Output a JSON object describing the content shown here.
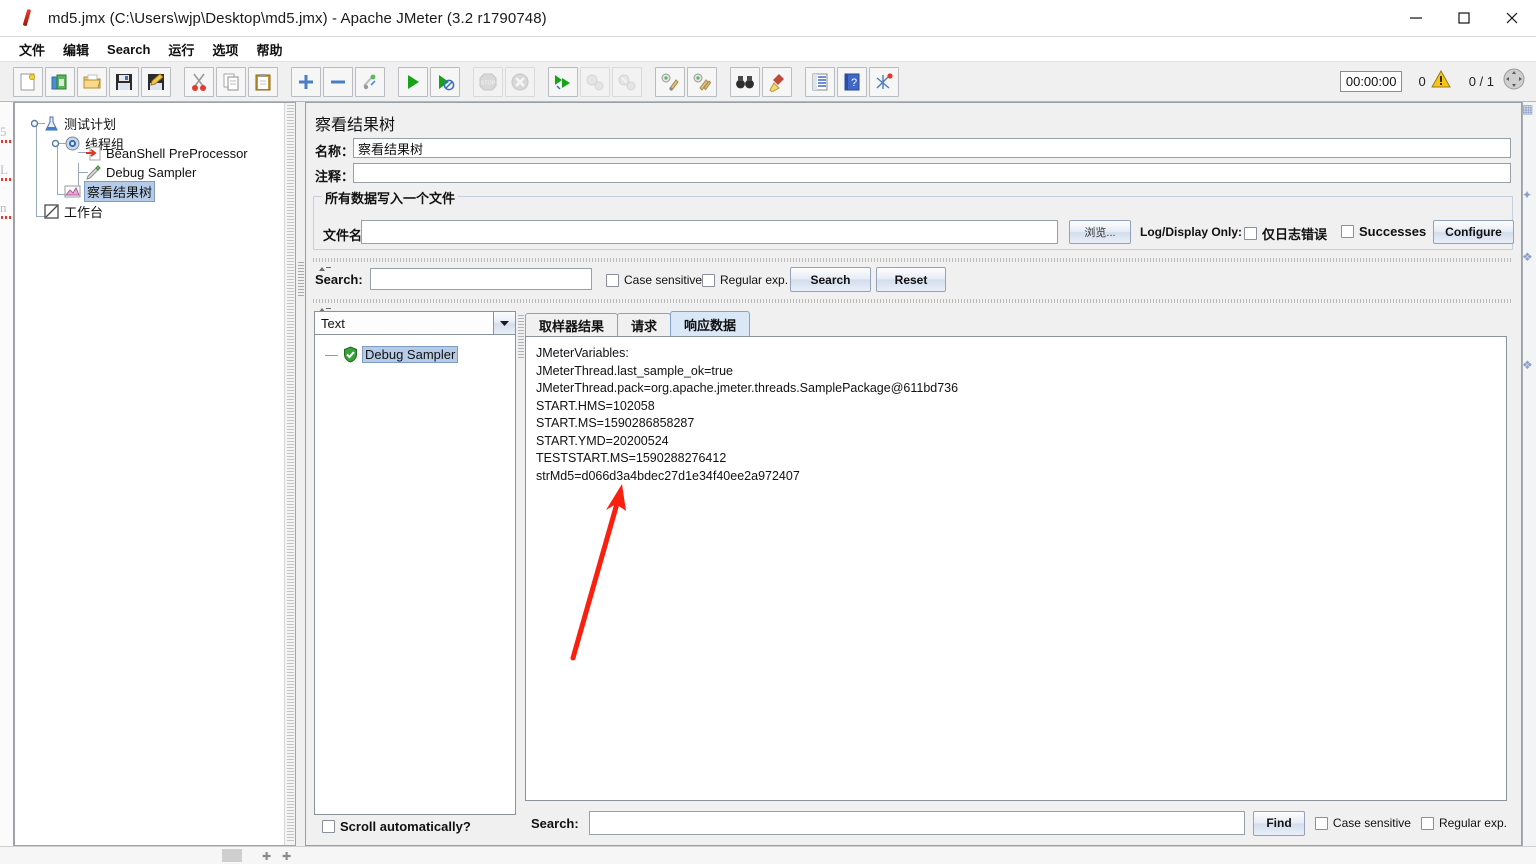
{
  "window": {
    "title": "md5.jmx (C:\\Users\\wjp\\Desktop\\md5.jmx) - Apache JMeter (3.2 r1790748)",
    "app_icon": "jmeter-feather-icon",
    "minimize_label": "minimize-icon",
    "maximize_label": "maximize-icon",
    "close_label": "close-icon"
  },
  "menu": {
    "items": [
      {
        "label": "文件",
        "name": "menu-file"
      },
      {
        "label": "编辑",
        "name": "menu-edit"
      },
      {
        "label": "Search",
        "name": "menu-search"
      },
      {
        "label": "运行",
        "name": "menu-run"
      },
      {
        "label": "选项",
        "name": "menu-options"
      },
      {
        "label": "帮助",
        "name": "menu-help"
      }
    ]
  },
  "toolbar": {
    "buttons": [
      {
        "icon": "new-file-icon",
        "name": "toolbar-new",
        "enabled": true
      },
      {
        "icon": "templates-icon",
        "name": "toolbar-templates",
        "enabled": true
      },
      {
        "icon": "open-folder-icon",
        "name": "toolbar-open",
        "enabled": true
      },
      {
        "icon": "save-icon",
        "name": "toolbar-save",
        "enabled": true
      },
      {
        "icon": "save-as-icon",
        "name": "toolbar-save-as",
        "enabled": true
      },
      {
        "icon": "cut-scissors-icon",
        "name": "toolbar-cut",
        "enabled": true
      },
      {
        "icon": "copy-icon",
        "name": "toolbar-copy",
        "enabled": true
      },
      {
        "icon": "paste-clipboard-icon",
        "name": "toolbar-paste",
        "enabled": true
      },
      {
        "icon": "expand-plus-icon",
        "name": "toolbar-expand-all",
        "enabled": true
      },
      {
        "icon": "collapse-minus-icon",
        "name": "toolbar-collapse-all",
        "enabled": true
      },
      {
        "icon": "toggle-icon",
        "name": "toolbar-toggle",
        "enabled": true
      },
      {
        "icon": "start-play-icon",
        "name": "toolbar-start",
        "enabled": true
      },
      {
        "icon": "start-no-pauses-icon",
        "name": "toolbar-start-no-pauses",
        "enabled": true
      },
      {
        "icon": "stop-icon",
        "name": "toolbar-stop",
        "enabled": false
      },
      {
        "icon": "shutdown-icon",
        "name": "toolbar-shutdown",
        "enabled": false
      },
      {
        "icon": "remote-start-all-icon",
        "name": "toolbar-remote-start-all",
        "enabled": true
      },
      {
        "icon": "remote-stop-all-icon",
        "name": "toolbar-remote-stop-all",
        "enabled": false
      },
      {
        "icon": "remote-shutdown-all-icon",
        "name": "toolbar-remote-shutdown-all",
        "enabled": false
      },
      {
        "icon": "clear-icon",
        "name": "toolbar-clear",
        "enabled": true
      },
      {
        "icon": "clear-all-icon",
        "name": "toolbar-clear-all",
        "enabled": true
      },
      {
        "icon": "search-binoculars-icon",
        "name": "toolbar-search",
        "enabled": true
      },
      {
        "icon": "search-reset-broom-icon",
        "name": "toolbar-search-reset",
        "enabled": true
      },
      {
        "icon": "function-helper-icon",
        "name": "toolbar-function-helper",
        "enabled": true
      },
      {
        "icon": "help-book-icon",
        "name": "toolbar-help",
        "enabled": true
      },
      {
        "icon": "heap-dump-icon",
        "name": "toolbar-heap-dump",
        "enabled": true
      }
    ],
    "timer": "00:00:00",
    "error_count": "0",
    "warning_icon": "warning-triangle-icon",
    "thread_count": "0 / 1",
    "status_icon": "expand-circle-icon"
  },
  "tree": {
    "nodes": [
      {
        "label": "测试计划",
        "icon": "test-plan-icon",
        "name": "tree-node-test-plan",
        "selected": false
      },
      {
        "label": "线程组",
        "icon": "thread-group-icon",
        "name": "tree-node-thread-group",
        "selected": false
      },
      {
        "label": "BeanShell PreProcessor",
        "icon": "preprocessor-icon",
        "name": "tree-node-beanshell-preprocessor",
        "selected": false
      },
      {
        "label": "Debug Sampler",
        "icon": "sampler-icon",
        "name": "tree-node-debug-sampler",
        "selected": false
      },
      {
        "label": "察看结果树",
        "icon": "view-results-tree-icon",
        "name": "tree-node-view-results-tree",
        "selected": true
      },
      {
        "label": "工作台",
        "icon": "workbench-icon",
        "name": "tree-node-workbench",
        "selected": false
      }
    ]
  },
  "panel": {
    "title": "察看结果树",
    "name_label": "名称：",
    "name_value": "察看结果树",
    "comment_label": "注释：",
    "comment_value": "",
    "file_group_legend": "所有数据写入一个文件",
    "filename_label": "文件名",
    "filename_value": "",
    "browse_button": "浏览...",
    "log_display_only_label": "Log/Display Only:",
    "errors_checkbox": "仅日志错误",
    "successes_checkbox": "Successes",
    "configure_button": "Configure"
  },
  "search_top": {
    "label": "Search:",
    "value": "",
    "case_sensitive": "Case sensitive",
    "regular_exp": "Regular exp.",
    "search_button": "Search",
    "reset_button": "Reset"
  },
  "results": {
    "render_combo_value": "Text",
    "render_combo_arrow": "chevron-down-icon",
    "sampler_entries": [
      {
        "label": "Debug Sampler",
        "icon": "success-shield-icon",
        "selected": true
      }
    ],
    "scroll_automatically_label": "Scroll automatically?",
    "tabs": [
      {
        "label": "取样器结果",
        "name": "tab-sampler-result",
        "active": false
      },
      {
        "label": "请求",
        "name": "tab-request",
        "active": false
      },
      {
        "label": "响应数据",
        "name": "tab-response-data",
        "active": true
      }
    ],
    "response_lines": [
      "JMeterVariables:",
      "JMeterThread.last_sample_ok=true",
      "JMeterThread.pack=org.apache.jmeter.threads.SamplePackage@611bd736",
      "START.HMS=102058",
      "START.MS=1590286858287",
      "START.YMD=20200524",
      "TESTSTART.MS=1590288276412",
      "strMd5=d066d3a4bdec27d1e34f40ee2a972407"
    ]
  },
  "search_bottom": {
    "label": "Search:",
    "value": "",
    "find_button": "Find",
    "case_sensitive": "Case sensitive",
    "regular_exp": "Regular exp."
  },
  "annotation": {
    "arrow_color": "#fa2010",
    "arrow_name": "red-annotation-arrow"
  },
  "colors": {
    "accent": "#d9e7f7",
    "selection": "#b5cbe8",
    "panel": "#f0f0f0",
    "border": "#9aa0a8"
  }
}
